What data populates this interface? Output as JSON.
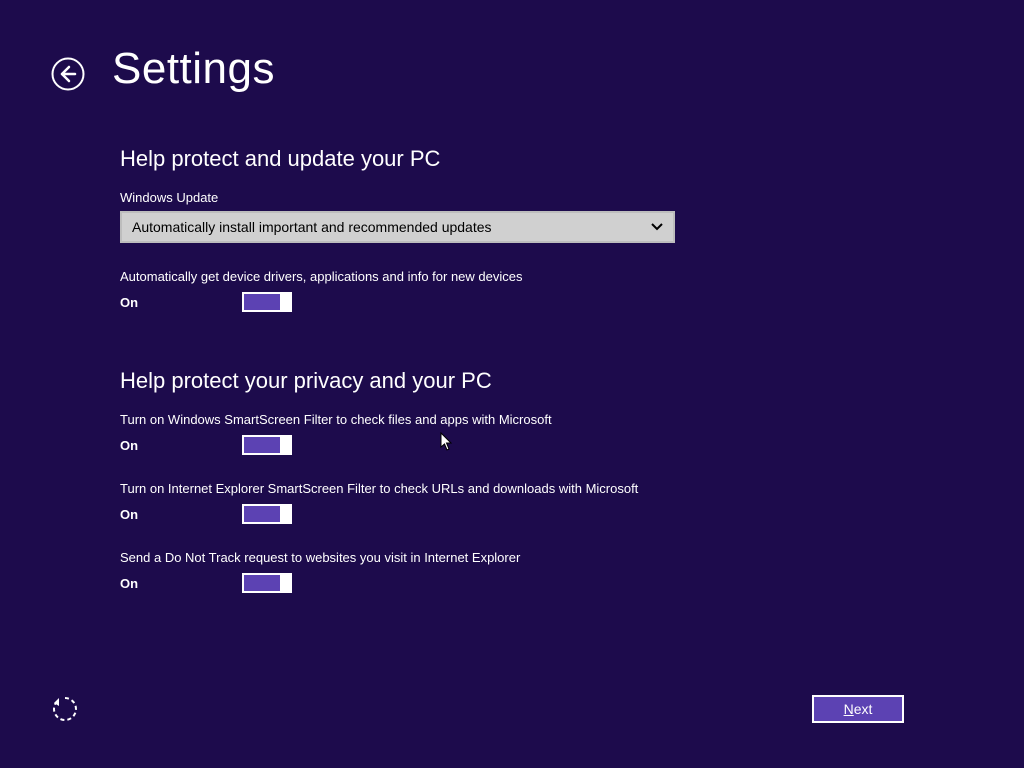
{
  "header": {
    "title": "Settings"
  },
  "sections": {
    "protectUpdate": {
      "heading": "Help protect and update your PC",
      "windowsUpdateLabel": "Windows Update",
      "dropdownValue": "Automatically install important and recommended updates",
      "toggle1": {
        "desc": "Automatically get device drivers, applications and info for new devices",
        "state": "On"
      }
    },
    "privacy": {
      "heading": "Help protect your privacy and your PC",
      "toggle1": {
        "desc": "Turn on Windows SmartScreen Filter to check files and apps with Microsoft",
        "state": "On"
      },
      "toggle2": {
        "desc": "Turn on Internet Explorer SmartScreen Filter to check URLs and downloads with Microsoft",
        "state": "On"
      },
      "toggle3": {
        "desc": "Send a Do Not Track request to websites you visit in Internet Explorer",
        "state": "On"
      }
    }
  },
  "footer": {
    "nextFirstLetter": "N",
    "nextRest": "ext"
  }
}
